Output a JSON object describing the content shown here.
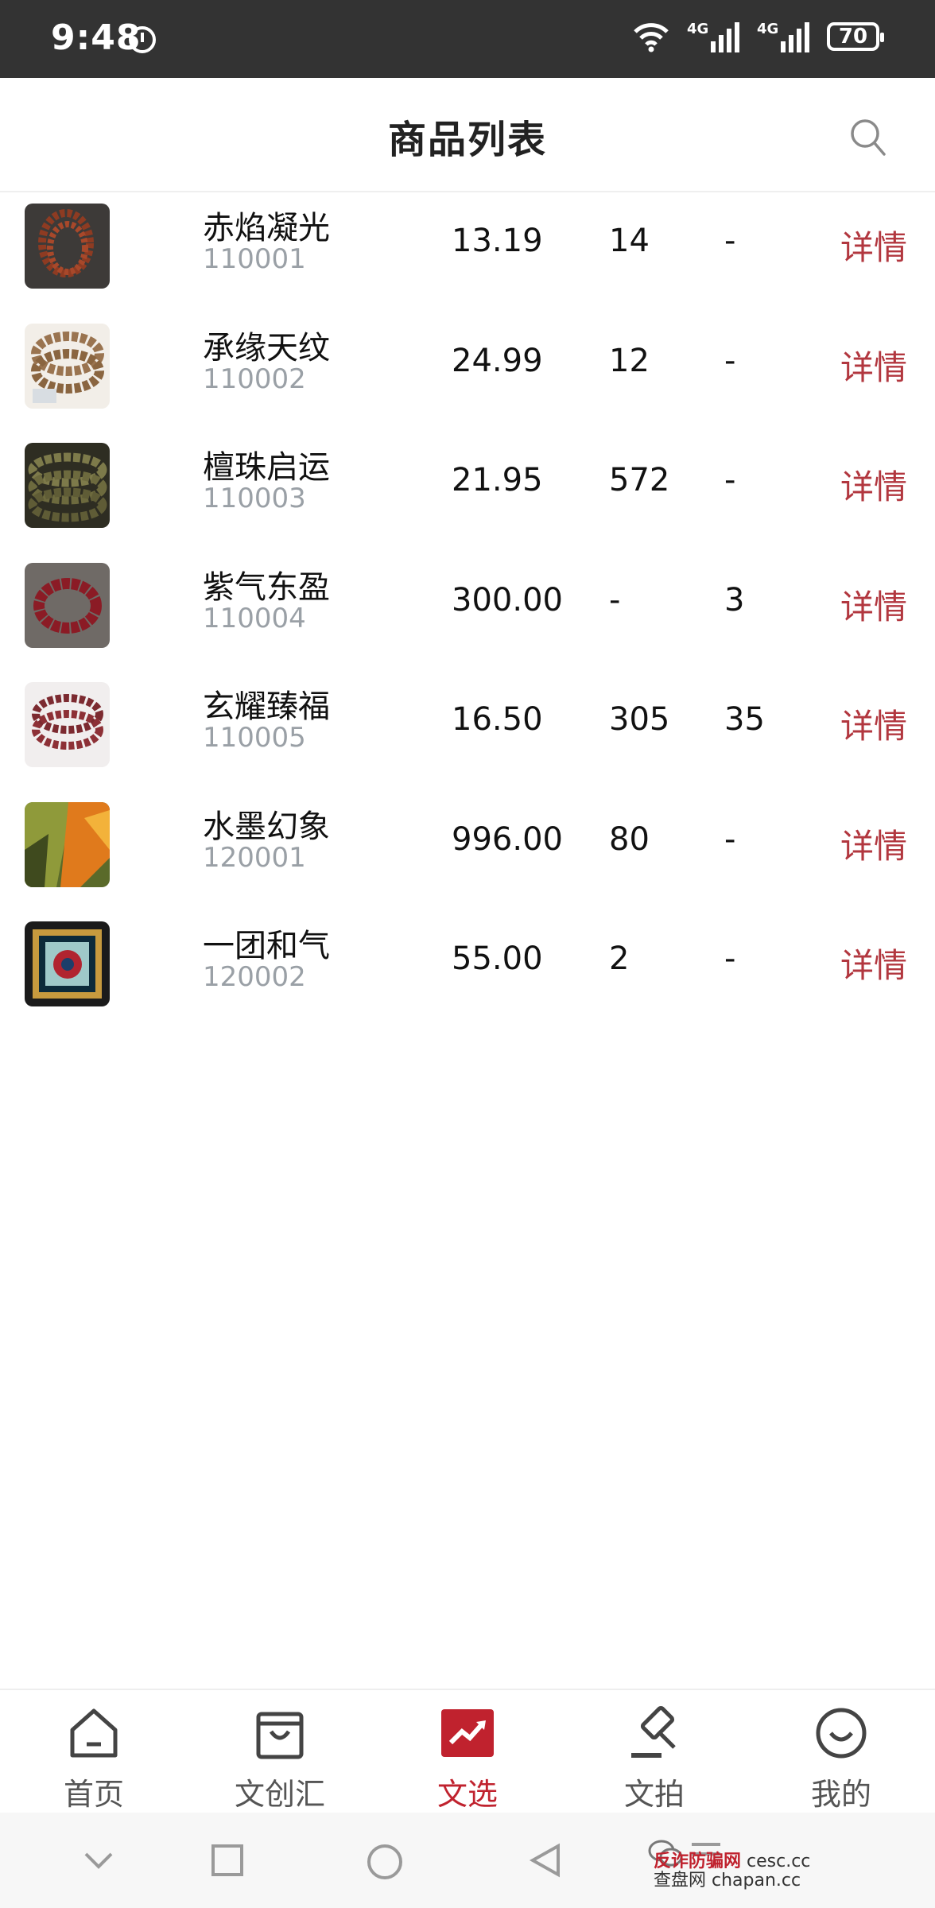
{
  "status": {
    "time": "9:48",
    "net1": "4G",
    "net2": "4G",
    "battery": "70"
  },
  "header": {
    "title": "商品列表"
  },
  "products": [
    {
      "name": "赤焰凝光",
      "code": "110001",
      "price": "13.19",
      "col2": "14",
      "col3": "-",
      "detail": "详情"
    },
    {
      "name": "承缘天纹",
      "code": "110002",
      "price": "24.99",
      "col2": "12",
      "col3": "-",
      "detail": "详情"
    },
    {
      "name": "檀珠启运",
      "code": "110003",
      "price": "21.95",
      "col2": "572",
      "col3": "-",
      "detail": "详情"
    },
    {
      "name": "紫气东盈",
      "code": "110004",
      "price": "300.00",
      "col2": "-",
      "col3": "3",
      "detail": "详情"
    },
    {
      "name": "玄耀臻福",
      "code": "110005",
      "price": "16.50",
      "col2": "305",
      "col3": "35",
      "detail": "详情"
    },
    {
      "name": "水墨幻象",
      "code": "120001",
      "price": "996.00",
      "col2": "80",
      "col3": "-",
      "detail": "详情"
    },
    {
      "name": "一团和气",
      "code": "120002",
      "price": "55.00",
      "col2": "2",
      "col3": "-",
      "detail": "详情"
    }
  ],
  "nav": [
    {
      "label": "首页",
      "icon": "home-icon"
    },
    {
      "label": "文创汇",
      "icon": "bag-icon"
    },
    {
      "label": "文选",
      "icon": "trend-icon"
    },
    {
      "label": "文拍",
      "icon": "gavel-icon"
    },
    {
      "label": "我的",
      "icon": "smile-icon"
    }
  ],
  "colors": {
    "accent": "#c0222e",
    "detail": "#b2373f",
    "statusbar": "#333333"
  },
  "watermark": {
    "line1": "反诈防骗网",
    "line1b": "cesc.cc",
    "line2": "查盘网",
    "line2b": "chapan.cc"
  }
}
